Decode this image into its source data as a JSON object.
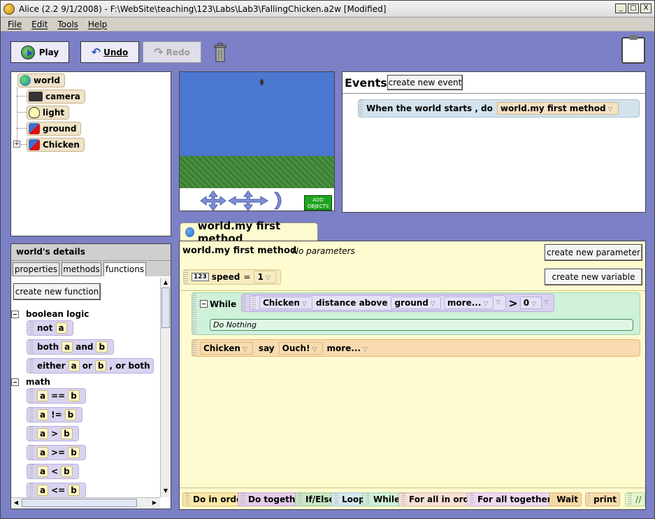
{
  "window": {
    "title": "Alice (2.2  9/1/2008) - F:\\WebSite\\teaching\\123\\Labs\\Lab3\\FallingChicken.a2w [Modified]",
    "controls": [
      "_",
      "□",
      "X"
    ]
  },
  "menu": [
    "File",
    "Edit",
    "Tools",
    "Help"
  ],
  "toolbar": {
    "play": "Play",
    "undo": "Undo",
    "redo": "Redo"
  },
  "object_tree": [
    {
      "label": "world",
      "icon": "globe-icon"
    },
    {
      "label": "camera",
      "icon": "camera-icon"
    },
    {
      "label": "light",
      "icon": "light-bulb-icon"
    },
    {
      "label": "ground",
      "icon": "ground-icon"
    },
    {
      "label": "Chicken",
      "icon": "chicken-icon"
    }
  ],
  "world_view": {
    "add_objects": "ADD OBJECTS"
  },
  "events": {
    "title": "Events",
    "create_button": "create new event",
    "event_text": "When the world starts ,  do",
    "event_method": "world.my first method"
  },
  "details": {
    "title": "world's details",
    "tabs": [
      "properties",
      "methods",
      "functions"
    ],
    "create_button": "create new function",
    "categories": {
      "boolean": "boolean logic",
      "math": "math"
    },
    "boolean_items": [
      {
        "parts": [
          "not",
          "a"
        ]
      },
      {
        "parts": [
          "both",
          "a",
          "and",
          "b"
        ]
      },
      {
        "parts": [
          "either",
          "a",
          "or",
          "b",
          ", or both"
        ]
      }
    ],
    "math_items": [
      {
        "a": "a",
        "op": "==",
        "b": "b"
      },
      {
        "a": "a",
        "op": "!=",
        "b": "b"
      },
      {
        "a": "a",
        "op": ">",
        "b": "b"
      },
      {
        "a": "a",
        "op": ">=",
        "b": "b"
      },
      {
        "a": "a",
        "op": "<",
        "b": "b"
      },
      {
        "a": "a",
        "op": "<=",
        "b": "b"
      }
    ]
  },
  "editor": {
    "tab_title": "world.my first method",
    "method_name": "world.my first method",
    "params": "No parameters",
    "create_param": "create new parameter",
    "create_var": "create new variable",
    "var_icon": "123",
    "var_name": "speed",
    "var_eq": "=",
    "var_value": "1",
    "while_label": "While",
    "while_obj": "Chicken",
    "while_func": "distance above",
    "while_arg": "ground",
    "while_more": "more...",
    "while_op": ">",
    "while_val": "0",
    "do_nothing": "Do Nothing",
    "say_obj": "Chicken",
    "say_verb": "say",
    "say_val": "Ouch!",
    "say_more": "more..."
  },
  "bottom_tiles": [
    "Do in order",
    "Do together",
    "If/Else",
    "Loop",
    "While",
    "For all in order",
    "For all together",
    "Wait",
    "print",
    "//"
  ]
}
